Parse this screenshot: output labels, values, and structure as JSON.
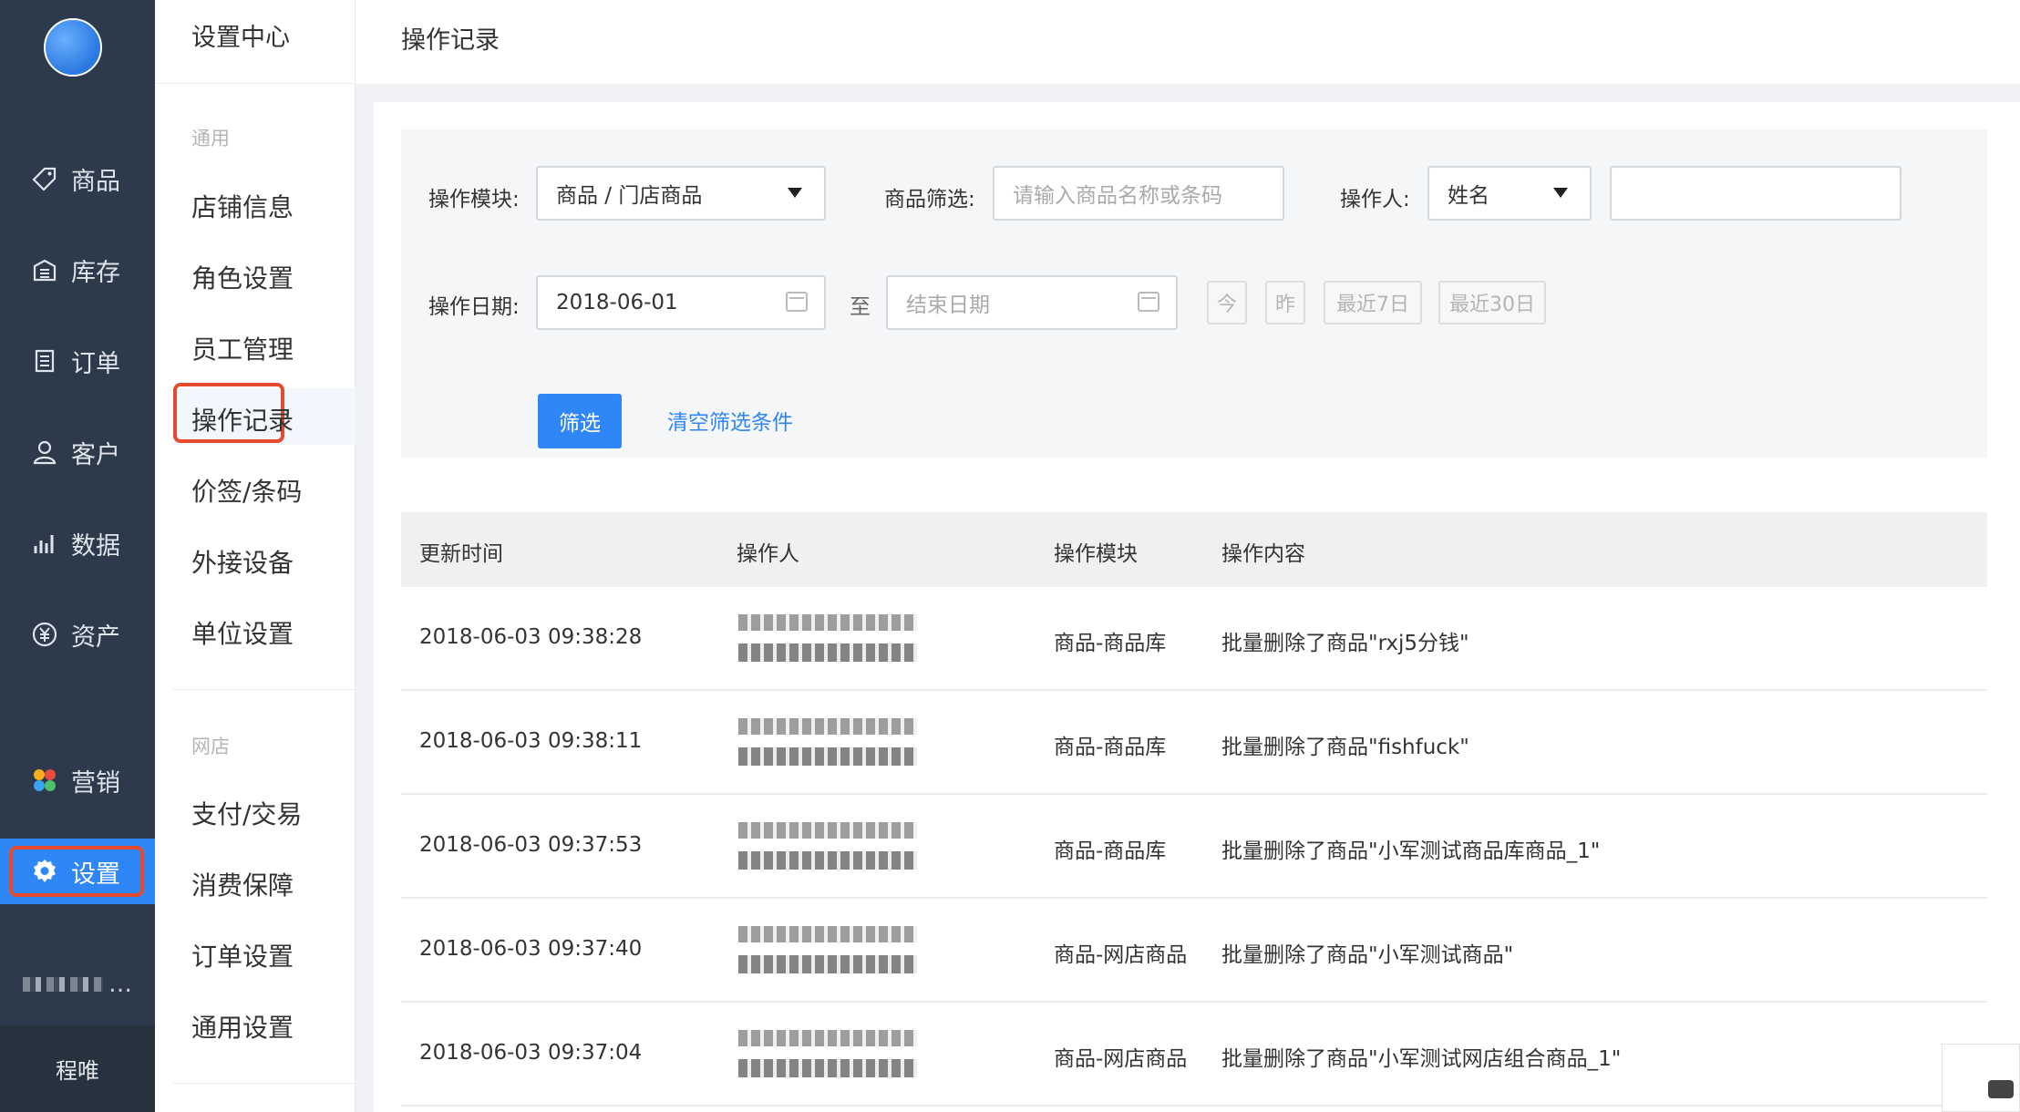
{
  "nav": {
    "items": [
      {
        "label": "商品",
        "icon": "tag-icon"
      },
      {
        "label": "库存",
        "icon": "warehouse-icon"
      },
      {
        "label": "订单",
        "icon": "list-icon"
      },
      {
        "label": "客户",
        "icon": "user-icon"
      },
      {
        "label": "数据",
        "icon": "bar-chart-icon"
      },
      {
        "label": "资产",
        "icon": "yen-icon"
      },
      {
        "label": "营销",
        "icon": "marketing-icon"
      },
      {
        "label": "设置",
        "icon": "gear-icon"
      }
    ],
    "active": "设置",
    "bottom_label": "程唯",
    "active_color": "#2f86f6",
    "highlight_color": "#e64a2e"
  },
  "submenu": {
    "title": "设置中心",
    "groups": [
      {
        "label": "通用",
        "items": [
          "店铺信息",
          "角色设置",
          "员工管理",
          "操作记录",
          "价签/条码",
          "外接设备",
          "单位设置"
        ]
      },
      {
        "label": "网店",
        "items": [
          "支付/交易",
          "消费保障",
          "订单设置",
          "通用设置"
        ]
      }
    ],
    "active": "操作记录"
  },
  "page": {
    "title": "操作记录"
  },
  "filter": {
    "module_label": "操作模块:",
    "module_value": "商品 / 门店商品",
    "goods_label": "商品筛选:",
    "goods_placeholder": "请输入商品名称或条码",
    "operator_label": "操作人:",
    "operator_value": "姓名",
    "operator_input": "",
    "date_label": "操作日期:",
    "date_start": "2018-06-01",
    "date_to": "至",
    "date_end_placeholder": "结束日期",
    "quick": [
      "今",
      "昨",
      "最近7日",
      "最近30日"
    ],
    "submit": "筛选",
    "clear": "清空筛选条件"
  },
  "table": {
    "headers": [
      "更新时间",
      "操作人",
      "操作模块",
      "操作内容"
    ],
    "rows": [
      {
        "time": "2018-06-03 09:38:28",
        "module": "商品-商品库",
        "content": "批量删除了商品\"rxj5分钱\""
      },
      {
        "time": "2018-06-03 09:38:11",
        "module": "商品-商品库",
        "content": "批量删除了商品\"fishfuck\""
      },
      {
        "time": "2018-06-03 09:37:53",
        "module": "商品-商品库",
        "content": "批量删除了商品\"小军测试商品库商品_1\""
      },
      {
        "time": "2018-06-03 09:37:40",
        "module": "商品-网店商品",
        "content": "批量删除了商品\"小军测试商品\""
      },
      {
        "time": "2018-06-03 09:37:04",
        "module": "商品-网店商品",
        "content": "批量删除了商品\"小军测试网店组合商品_1\""
      }
    ]
  }
}
